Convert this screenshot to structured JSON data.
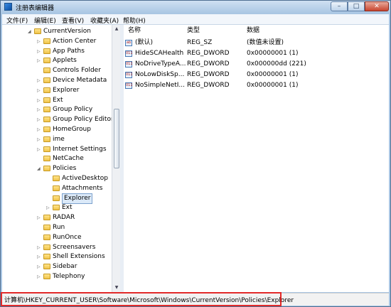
{
  "window": {
    "title": "注册表编辑器"
  },
  "menu": [
    "文件(F)",
    "编辑(E)",
    "查看(V)",
    "收藏夹(A)",
    "帮助(H)"
  ],
  "tree": {
    "items": [
      {
        "label": "CurrentVersion",
        "indent": 0,
        "expander": "◢"
      },
      {
        "label": "Action Center",
        "indent": 1,
        "expander": "▷"
      },
      {
        "label": "App Paths",
        "indent": 1,
        "expander": "▷"
      },
      {
        "label": "Applets",
        "indent": 1,
        "expander": "▷"
      },
      {
        "label": "Controls Folder",
        "indent": 1,
        "expander": ""
      },
      {
        "label": "Device Metadata",
        "indent": 1,
        "expander": "▷"
      },
      {
        "label": "Explorer",
        "indent": 1,
        "expander": "▷"
      },
      {
        "label": "Ext",
        "indent": 1,
        "expander": "▷"
      },
      {
        "label": "Group Policy",
        "indent": 1,
        "expander": "▷"
      },
      {
        "label": "Group Policy Editor",
        "indent": 1,
        "expander": "▷"
      },
      {
        "label": "HomeGroup",
        "indent": 1,
        "expander": "▷"
      },
      {
        "label": "ime",
        "indent": 1,
        "expander": "▷"
      },
      {
        "label": "Internet Settings",
        "indent": 1,
        "expander": "▷"
      },
      {
        "label": "NetCache",
        "indent": 1,
        "expander": ""
      },
      {
        "label": "Policies",
        "indent": 1,
        "expander": "◢"
      },
      {
        "label": "ActiveDesktop",
        "indent": 2,
        "expander": ""
      },
      {
        "label": "Attachments",
        "indent": 2,
        "expander": ""
      },
      {
        "label": "Explorer",
        "indent": 2,
        "expander": "",
        "selected": true
      },
      {
        "label": "Ext",
        "indent": 2,
        "expander": "▷"
      },
      {
        "label": "RADAR",
        "indent": 1,
        "expander": "▷"
      },
      {
        "label": "Run",
        "indent": 1,
        "expander": ""
      },
      {
        "label": "RunOnce",
        "indent": 1,
        "expander": ""
      },
      {
        "label": "Screensavers",
        "indent": 1,
        "expander": "▷"
      },
      {
        "label": "Shell Extensions",
        "indent": 1,
        "expander": "▷"
      },
      {
        "label": "Sidebar",
        "indent": 1,
        "expander": "▷"
      },
      {
        "label": "Telephony",
        "indent": 1,
        "expander": "▷"
      }
    ]
  },
  "list": {
    "columns": [
      "名称",
      "类型",
      "数据"
    ],
    "rows": [
      {
        "icon": "ab",
        "name": "(默认)",
        "type": "REG_SZ",
        "data": "(数值未设置)"
      },
      {
        "icon": "011",
        "name": "HideSCAHealth",
        "type": "REG_DWORD",
        "data": "0x00000001 (1)"
      },
      {
        "icon": "011",
        "name": "NoDriveTypeA...",
        "type": "REG_DWORD",
        "data": "0x000000dd (221)"
      },
      {
        "icon": "011",
        "name": "NoLowDiskSp...",
        "type": "REG_DWORD",
        "data": "0x00000001 (1)"
      },
      {
        "icon": "011",
        "name": "NoSimpleNetI...",
        "type": "REG_DWORD",
        "data": "0x00000001 (1)"
      }
    ]
  },
  "status": {
    "path": "计算机\\HKEY_CURRENT_USER\\Software\\Microsoft\\Windows\\CurrentVersion\\Policies\\Explorer"
  },
  "colors": {
    "highlight_border": "#e22a2a",
    "selection_bg": "#dbe9f8"
  }
}
